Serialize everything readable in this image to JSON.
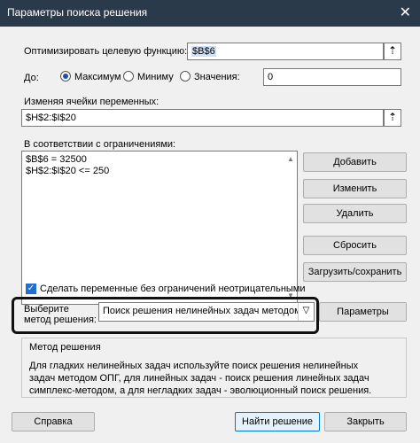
{
  "window": {
    "title": "Параметры поиска решения",
    "close_glyph": "✕"
  },
  "objective": {
    "label": "Оптимизировать целевую функцию:",
    "value": "$B$6"
  },
  "to": {
    "label": "До:",
    "options": [
      {
        "label": "Максимум",
        "selected": true
      },
      {
        "label": "Миниму",
        "selected": false
      },
      {
        "label": "Значения:",
        "selected": false
      }
    ],
    "value": "0"
  },
  "variables": {
    "label": "Изменяя ячейки переменных:",
    "value": "$H$2:$I$20"
  },
  "constraints": {
    "label": "В соответствии с ограничениями:",
    "items": [
      "$B$6 = 32500",
      "$H$2:$I$20 <= 250"
    ]
  },
  "side_buttons": {
    "add": "Добавить",
    "change": "Изменить",
    "delete": "Удалить",
    "reset": "Сбросить",
    "load_save": "Загрузить/сохранить"
  },
  "nonnegative": {
    "label": "Сделать переменные без ограничений неотрицательными",
    "checked": true
  },
  "method": {
    "label_line1": "Выберите",
    "label_line2": "метод решения:",
    "selected": "Поиск решения нелинейных задач методом ОПГ",
    "options_button": "Параметры"
  },
  "method_group": {
    "title": "Метод решения",
    "description": "Для гладких нелинейных задач используйте поиск решения нелинейных задач методом ОПГ, для линейных задач - поиск решения линейных задач симплекс-методом, а для негладких задач - эволюционный поиск решения."
  },
  "footer": {
    "help": "Справка",
    "solve": "Найти решение",
    "close": "Закрыть"
  },
  "colors": {
    "titlebar": "#2b3a4a",
    "accent": "#1f6fd6",
    "dialog_bg": "#f0f0f0"
  }
}
